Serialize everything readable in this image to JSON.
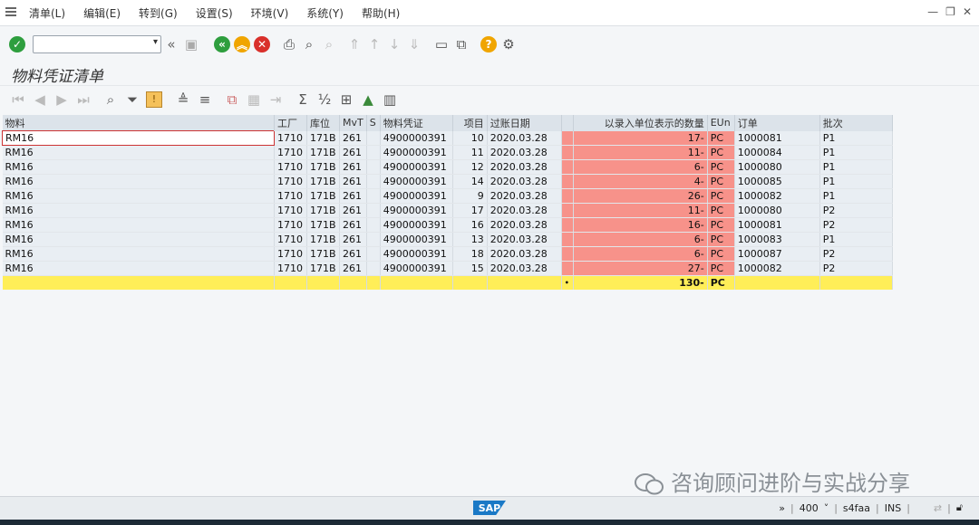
{
  "menu": [
    "清单(L)",
    "编辑(E)",
    "转到(G)",
    "设置(S)",
    "环境(V)",
    "系统(Y)",
    "帮助(H)"
  ],
  "title": "物料凭证清单",
  "columns": [
    "物料",
    "工厂",
    "库位",
    "MvT",
    "S",
    "物料凭证",
    "项目",
    "过账日期",
    "",
    "以录入单位表示的数量",
    "EUn",
    "订单",
    "批次"
  ],
  "rows": [
    {
      "material": "RM16",
      "plant": "1710",
      "sloc": "171B",
      "mvt": "261",
      "s": "",
      "doc": "4900000391",
      "item": "10",
      "date": "2020.03.28",
      "qty": "17-",
      "unit": "PC",
      "order": "1000081",
      "batch": "P1"
    },
    {
      "material": "RM16",
      "plant": "1710",
      "sloc": "171B",
      "mvt": "261",
      "s": "",
      "doc": "4900000391",
      "item": "11",
      "date": "2020.03.28",
      "qty": "11-",
      "unit": "PC",
      "order": "1000084",
      "batch": "P1"
    },
    {
      "material": "RM16",
      "plant": "1710",
      "sloc": "171B",
      "mvt": "261",
      "s": "",
      "doc": "4900000391",
      "item": "12",
      "date": "2020.03.28",
      "qty": "6-",
      "unit": "PC",
      "order": "1000080",
      "batch": "P1"
    },
    {
      "material": "RM16",
      "plant": "1710",
      "sloc": "171B",
      "mvt": "261",
      "s": "",
      "doc": "4900000391",
      "item": "14",
      "date": "2020.03.28",
      "qty": "4-",
      "unit": "PC",
      "order": "1000085",
      "batch": "P1"
    },
    {
      "material": "RM16",
      "plant": "1710",
      "sloc": "171B",
      "mvt": "261",
      "s": "",
      "doc": "4900000391",
      "item": "9",
      "date": "2020.03.28",
      "qty": "26-",
      "unit": "PC",
      "order": "1000082",
      "batch": "P1"
    },
    {
      "material": "RM16",
      "plant": "1710",
      "sloc": "171B",
      "mvt": "261",
      "s": "",
      "doc": "4900000391",
      "item": "17",
      "date": "2020.03.28",
      "qty": "11-",
      "unit": "PC",
      "order": "1000080",
      "batch": "P2"
    },
    {
      "material": "RM16",
      "plant": "1710",
      "sloc": "171B",
      "mvt": "261",
      "s": "",
      "doc": "4900000391",
      "item": "16",
      "date": "2020.03.28",
      "qty": "16-",
      "unit": "PC",
      "order": "1000081",
      "batch": "P2"
    },
    {
      "material": "RM16",
      "plant": "1710",
      "sloc": "171B",
      "mvt": "261",
      "s": "",
      "doc": "4900000391",
      "item": "13",
      "date": "2020.03.28",
      "qty": "6-",
      "unit": "PC",
      "order": "1000083",
      "batch": "P1"
    },
    {
      "material": "RM16",
      "plant": "1710",
      "sloc": "171B",
      "mvt": "261",
      "s": "",
      "doc": "4900000391",
      "item": "18",
      "date": "2020.03.28",
      "qty": "6-",
      "unit": "PC",
      "order": "1000087",
      "batch": "P2"
    },
    {
      "material": "RM16",
      "plant": "1710",
      "sloc": "171B",
      "mvt": "261",
      "s": "",
      "doc": "4900000391",
      "item": "15",
      "date": "2020.03.28",
      "qty": "27-",
      "unit": "PC",
      "order": "1000082",
      "batch": "P2"
    }
  ],
  "total": {
    "marker": "•",
    "qty": "130-",
    "unit": "PC"
  },
  "watermark": "咨询顾问进阶与实战分享",
  "status": {
    "logo": "SAP",
    "arrows": "»",
    "client": "400",
    "system": "s4faa",
    "mode": "INS"
  },
  "colors": {
    "qty_highlight": "#f7928a",
    "total_row": "#ffee58",
    "header_bg": "#dce3ea"
  }
}
